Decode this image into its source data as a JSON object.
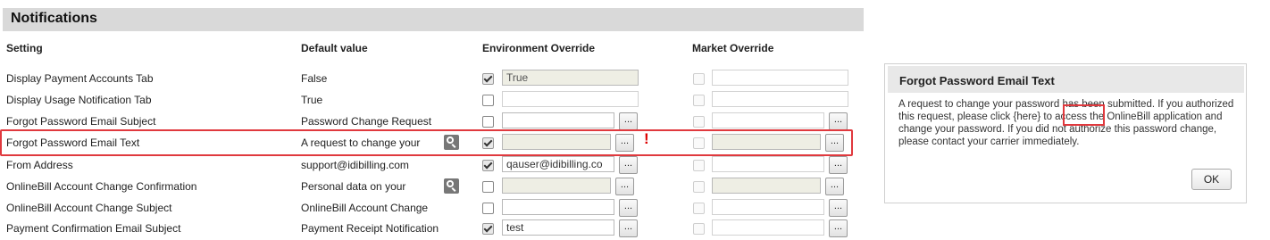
{
  "section": {
    "title": "Notifications"
  },
  "columns": {
    "setting": "Setting",
    "default": "Default value",
    "env": "Environment Override",
    "market": "Market Override"
  },
  "rows": [
    {
      "setting": "Display Payment Accounts Tab",
      "default": "False",
      "env_checked": true,
      "env_value": "True",
      "market_checked": false,
      "market_value": ""
    },
    {
      "setting": "Display Usage Notification Tab",
      "default": "True",
      "env_checked": false,
      "env_value": "",
      "market_checked": false,
      "market_value": ""
    },
    {
      "setting": "Forgot Password Email Subject",
      "default": "Password Change Request",
      "env_checked": false,
      "env_value": "",
      "market_checked": false,
      "market_value": ""
    },
    {
      "setting": "Forgot Password Email Text",
      "default": "A request to change your",
      "env_checked": true,
      "env_value": "",
      "market_checked": false,
      "market_value": ""
    },
    {
      "setting": "From Address",
      "default": "support@idibilling.com",
      "env_checked": true,
      "env_value": "qauser@idibilling.co",
      "market_checked": false,
      "market_value": ""
    },
    {
      "setting": "OnlineBill Account Change Confirmation",
      "default": "Personal data on your",
      "env_checked": false,
      "env_value": "",
      "market_checked": false,
      "market_value": ""
    },
    {
      "setting": "OnlineBill Account Change Subject",
      "default": "OnlineBill Account Change",
      "env_checked": false,
      "env_value": "",
      "market_checked": false,
      "market_value": ""
    },
    {
      "setting": "Payment Confirmation Email Subject",
      "default": "Payment Receipt Notification",
      "env_checked": true,
      "env_value": "test",
      "market_checked": false,
      "market_value": ""
    }
  ],
  "ellipsis_label": "...",
  "warning_mark": "!",
  "dialog": {
    "title": "Forgot Password Email Text",
    "body": "A request to change your password has been submitted. If you authorized this request, please click {here} to access the OnlineBill application and change your password. If you did not authorize this password change, please contact your carrier immediately.",
    "ok_label": "OK"
  }
}
